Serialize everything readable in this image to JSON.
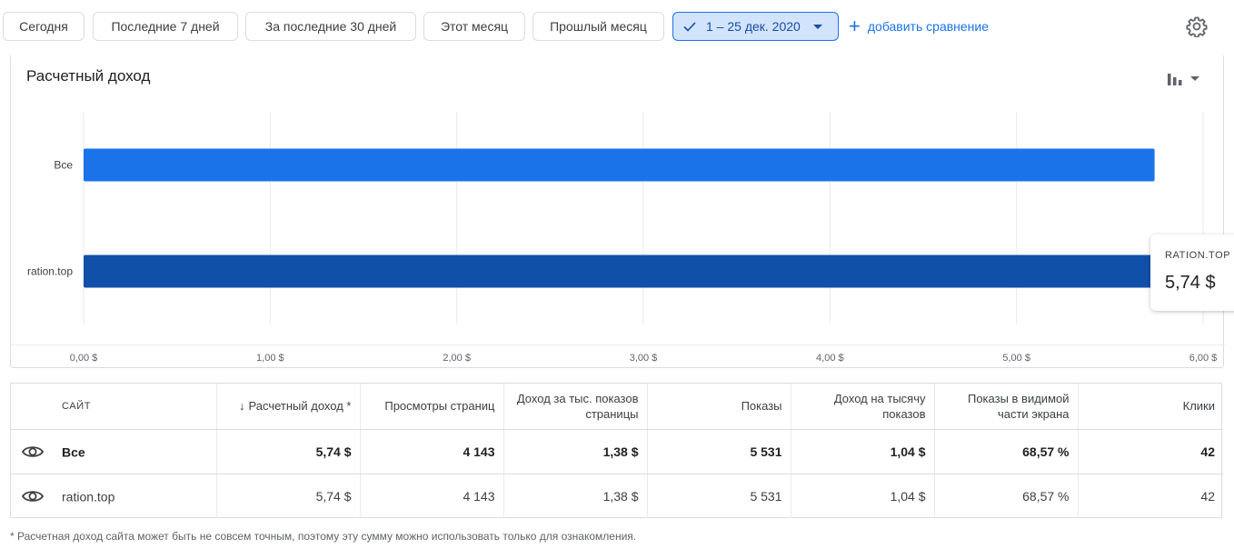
{
  "filters": {
    "chips": [
      "Сегодня",
      "Последние 7 дней",
      "За последние 30 дней",
      "Этот месяц",
      "Прошлый месяц"
    ],
    "selected_range": "1 – 25 дек. 2020",
    "add_comparison": "добавить сравнение",
    "settings_icon": "gear-icon"
  },
  "chart": {
    "title": "Расчетный доход",
    "chart_type_icon": "bar-chart-icon",
    "tooltip": {
      "label": "RATION.TOP",
      "value": "5,74 $"
    }
  },
  "chart_data": {
    "type": "bar",
    "orientation": "horizontal",
    "title": "Расчетный доход",
    "categories": [
      "Все",
      "ration.top"
    ],
    "values": [
      5.74,
      5.74
    ],
    "colors": [
      "#1a73e8",
      "#1150a8"
    ],
    "xlim": [
      0,
      6
    ],
    "x_ticks": [
      "0,00 $",
      "1,00 $",
      "2,00 $",
      "3,00 $",
      "4,00 $",
      "5,00 $",
      "6,00 $"
    ],
    "grid": true
  },
  "table": {
    "headers": [
      "САЙТ",
      "Расчетный доход *",
      "Просмотры страниц",
      "Доход за тыс. показов страницы",
      "Показы",
      "Доход на тысячу показов",
      "Показы в видимой части экрана",
      "Клики"
    ],
    "rows": [
      [
        "Все",
        "5,74 $",
        "4 143",
        "1,38 $",
        "5 531",
        "1,04 $",
        "68,57 %",
        "42"
      ],
      [
        "ration.top",
        "5,74 $",
        "4 143",
        "1,38 $",
        "5 531",
        "1,04 $",
        "68,57 %",
        "42"
      ]
    ],
    "row_icon": "eye-icon"
  },
  "footnote": "* Расчетная доход сайта может быть не совсем точным, поэтому эту сумму можно использовать только для ознакомления."
}
